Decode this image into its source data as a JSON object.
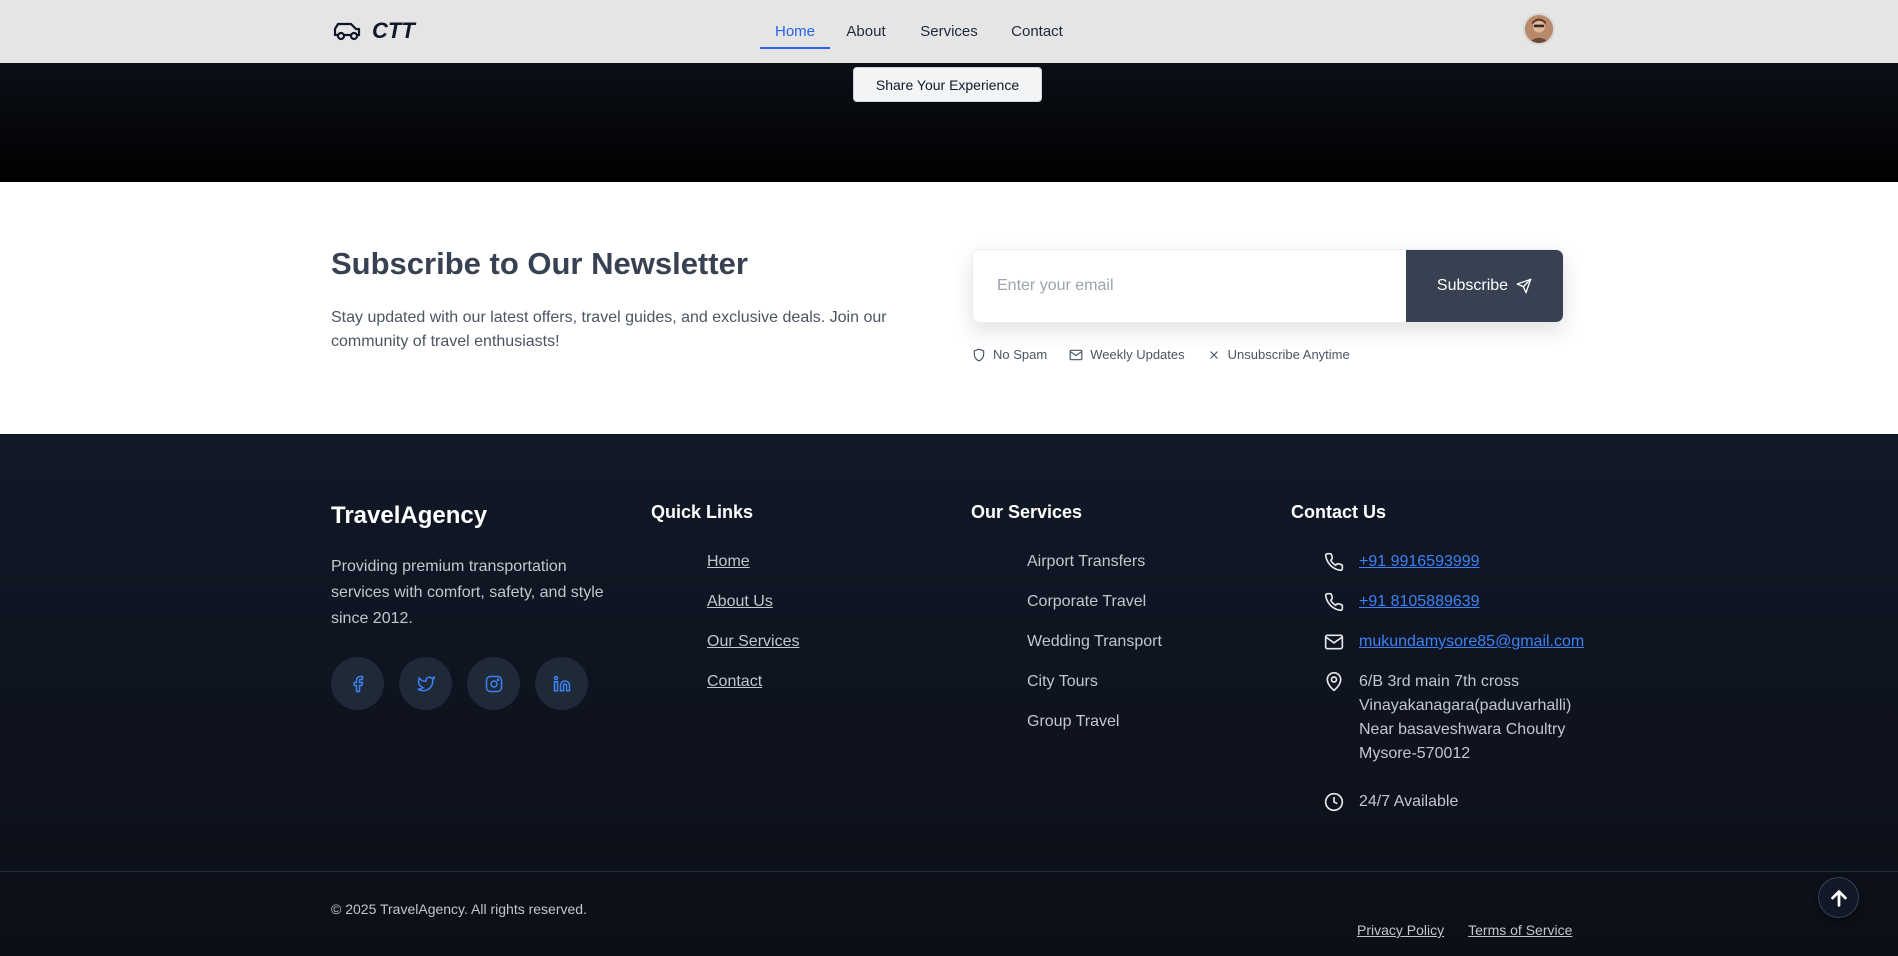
{
  "navbar": {
    "brand": "CTT",
    "links": [
      {
        "label": "Home",
        "active": true
      },
      {
        "label": "About"
      },
      {
        "label": "Services"
      },
      {
        "label": "Contact"
      }
    ]
  },
  "hero": {
    "share_button": "Share Your Experience"
  },
  "newsletter": {
    "title": "Subscribe to Our Newsletter",
    "description": "Stay updated with our latest offers, travel guides, and exclusive deals. Join our community of travel enthusiasts!",
    "email_placeholder": "Enter your email",
    "email_value": "",
    "subscribe_label": "Subscribe",
    "features": [
      {
        "icon": "shield-icon",
        "label": "No Spam"
      },
      {
        "icon": "mail-icon",
        "label": "Weekly Updates"
      },
      {
        "icon": "x-icon",
        "label": "Unsubscribe Anytime"
      }
    ]
  },
  "footer": {
    "brand": "TravelAgency",
    "description": "Providing premium transportation services with comfort, safety, and style since 2012.",
    "socials": [
      "facebook-icon",
      "twitter-icon",
      "instagram-icon",
      "linkedin-icon"
    ],
    "quick_links": {
      "title": "Quick Links",
      "items": [
        "Home",
        "About Us",
        "Our Services",
        "Contact"
      ]
    },
    "services": {
      "title": "Our Services",
      "items": [
        "Airport Transfers",
        "Corporate Travel",
        "Wedding Transport",
        "City Tours",
        "Group Travel"
      ]
    },
    "contact": {
      "title": "Contact Us",
      "phone1": "+91 9916593999",
      "phone2": "+91 8105889639",
      "email": "mukundamysore85@gmail.com",
      "address_lines": [
        "6/B 3rd main 7th cross",
        "Vinayakanagara(paduvarhalli)",
        "Near basaveshwara Choultry",
        "Mysore-570012"
      ],
      "hours": "24/7 Available"
    },
    "copyright": "© 2025 TravelAgency. All rights reserved.",
    "legal": [
      "Privacy Policy",
      "Terms of Service"
    ]
  },
  "colors": {
    "accent": "#2563eb",
    "link": "#3b82f6",
    "footer_bg": "#111827",
    "subscribe_bg": "#374151"
  }
}
